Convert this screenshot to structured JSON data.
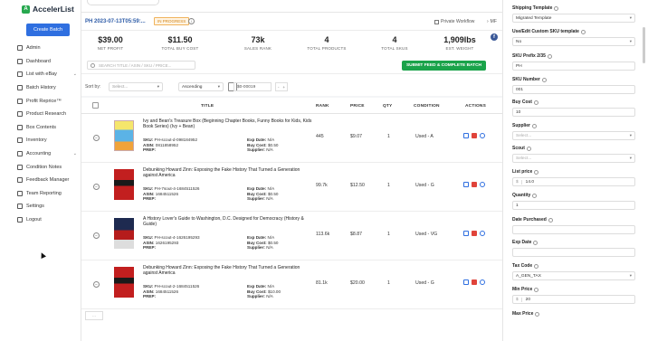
{
  "sidebar": {
    "brand": "AccelerList",
    "create_batch": "Create Batch",
    "items": [
      {
        "label": "Admin",
        "icon": "admin-icon"
      },
      {
        "label": "Dashboard",
        "icon": "dashboard-icon"
      },
      {
        "label": "List with eBay",
        "icon": "ebay-icon",
        "has_children": true
      },
      {
        "label": "Batch History",
        "icon": "history-icon"
      },
      {
        "label": "Profit Reprice™",
        "icon": "reprice-icon"
      },
      {
        "label": "Product Research",
        "icon": "research-icon"
      },
      {
        "label": "Box Contents",
        "icon": "box-icon"
      },
      {
        "label": "Inventory",
        "icon": "inventory-icon"
      },
      {
        "label": "Accounting",
        "icon": "accounting-icon",
        "has_children": true
      },
      {
        "label": "Condition Notes",
        "icon": "notes-icon"
      },
      {
        "label": "Feedback Manager",
        "icon": "feedback-icon"
      },
      {
        "label": "Team Reporting",
        "icon": "team-icon"
      },
      {
        "label": "Settings",
        "icon": "settings-icon"
      },
      {
        "label": "Logout",
        "icon": "logout-icon"
      }
    ]
  },
  "batch": {
    "id": "PH 2023-07-13T05:59:...",
    "status": "IN PROGRESS",
    "private_workflow": "Private Workflow",
    "mf": "MF"
  },
  "stats": [
    {
      "value": "$39.00",
      "label": "NET PROFIT"
    },
    {
      "value": "$11.50",
      "label": "TOTAL BUY COST"
    },
    {
      "value": "73k",
      "label": "SALES RANK"
    },
    {
      "value": "4",
      "label": "TOTAL PRODUCTS"
    },
    {
      "value": "4",
      "label": "TOTAL SKUS"
    },
    {
      "value": "1,909lbs",
      "label": "EST. WEIGHT"
    }
  ],
  "search": {
    "placeholder": "SEARCH TITLE / ASIN / SKU / PRICE..."
  },
  "submit_label": "SUBMIT FEED & COMPLETE BATCH",
  "sort": {
    "label": "Sort by:",
    "field_placeholder": "Select...",
    "direction": "Ascending",
    "date": "$0-00019"
  },
  "table": {
    "headers": {
      "title": "TITLE",
      "rank": "RANK",
      "price": "PRICE",
      "qty": "QTY",
      "condition": "CONDITION",
      "actions": "ACTIONS"
    },
    "rows": [
      {
        "title": "Ivy and Bean's Treasure Box (Beginning Chapter Books, Funny Books for Kids, Kids Book Series) (Ivy + Bean)",
        "sku": "PH-scout-d-098184952",
        "asin": "0811858952",
        "prep": "",
        "exp": "N/A",
        "buy_cost": "$0.50",
        "supplier": "N/A",
        "rank": "445",
        "price": "$9.07",
        "qty": "1",
        "condition": "Used - A",
        "cover": "a"
      },
      {
        "title": "Debunking Howard Zinn: Exposing the Fake History That Turned a Generation against America",
        "sku": "PH-7sout-4-1684511526",
        "asin": "1684511526",
        "prep": "",
        "exp": "N/A",
        "buy_cost": "$0.50",
        "supplier": "N/A",
        "rank": "99.7k",
        "price": "$12.50",
        "qty": "1",
        "condition": "Used - G",
        "cover": "b"
      },
      {
        "title": "A History Lover's Guide to Washington, D.C. Designed for Democracy (History & Guide)",
        "sku": "PH-scout-4-1626195293",
        "asin": "1626195293",
        "prep": "",
        "exp": "N/A",
        "buy_cost": "$0.50",
        "supplier": "N/A",
        "rank": "113.6k",
        "price": "$8.87",
        "qty": "1",
        "condition": "Used - VG",
        "cover": "c"
      },
      {
        "title": "Debunking Howard Zinn: Exposing the Fake History That Turned a Generation against America",
        "sku": "PH-scout-2-1684511526",
        "asin": "1684511526",
        "prep": "",
        "exp": "N/A",
        "buy_cost": "$10.00",
        "supplier": "N/A",
        "rank": "81.1k",
        "price": "$20.00",
        "qty": "1",
        "condition": "Used - G",
        "cover": "b"
      }
    ],
    "labels": {
      "sku": "SKU:",
      "asin": "ASIN:",
      "prep": "PREP:",
      "exp": "Exp Date:",
      "buy_cost": "Buy Cost:",
      "supplier": "Supplier:"
    }
  },
  "panel": {
    "fields": [
      {
        "label": "Shipping Template",
        "value": "Migrated Template",
        "type": "select",
        "info": true
      },
      {
        "label": "Use/Edit Custom SKU template",
        "value": "No",
        "type": "select",
        "info": true
      },
      {
        "label": "SKU Prefix 2/35",
        "value": "PH",
        "type": "text",
        "info": true
      },
      {
        "label": "SKU Number",
        "value": "001",
        "type": "text",
        "info": true
      },
      {
        "label": "Buy Cost",
        "value": "10",
        "type": "text",
        "info": true
      },
      {
        "label": "Supplier",
        "value": "Select...",
        "type": "select",
        "info": true,
        "placeholder": true
      },
      {
        "label": "Scout",
        "value": "Select...",
        "type": "select",
        "info": true,
        "placeholder": true
      },
      {
        "label": "List price",
        "value": "14.0",
        "prefix": "$",
        "type": "text",
        "info": true
      },
      {
        "label": "Quantity",
        "value": "1",
        "type": "text",
        "info": true
      },
      {
        "label": "Date Purchased",
        "value": "",
        "type": "text",
        "info": true
      },
      {
        "label": "Exp Date",
        "value": "",
        "type": "text",
        "info": true
      },
      {
        "label": "Tax Code",
        "value": "A_GEN_TAX",
        "type": "select",
        "info": true
      },
      {
        "label": "Min Price",
        "value": "20",
        "prefix": "$",
        "type": "text",
        "info": true
      },
      {
        "label": "Max Price",
        "value": "",
        "type": "text",
        "info": true
      }
    ]
  }
}
